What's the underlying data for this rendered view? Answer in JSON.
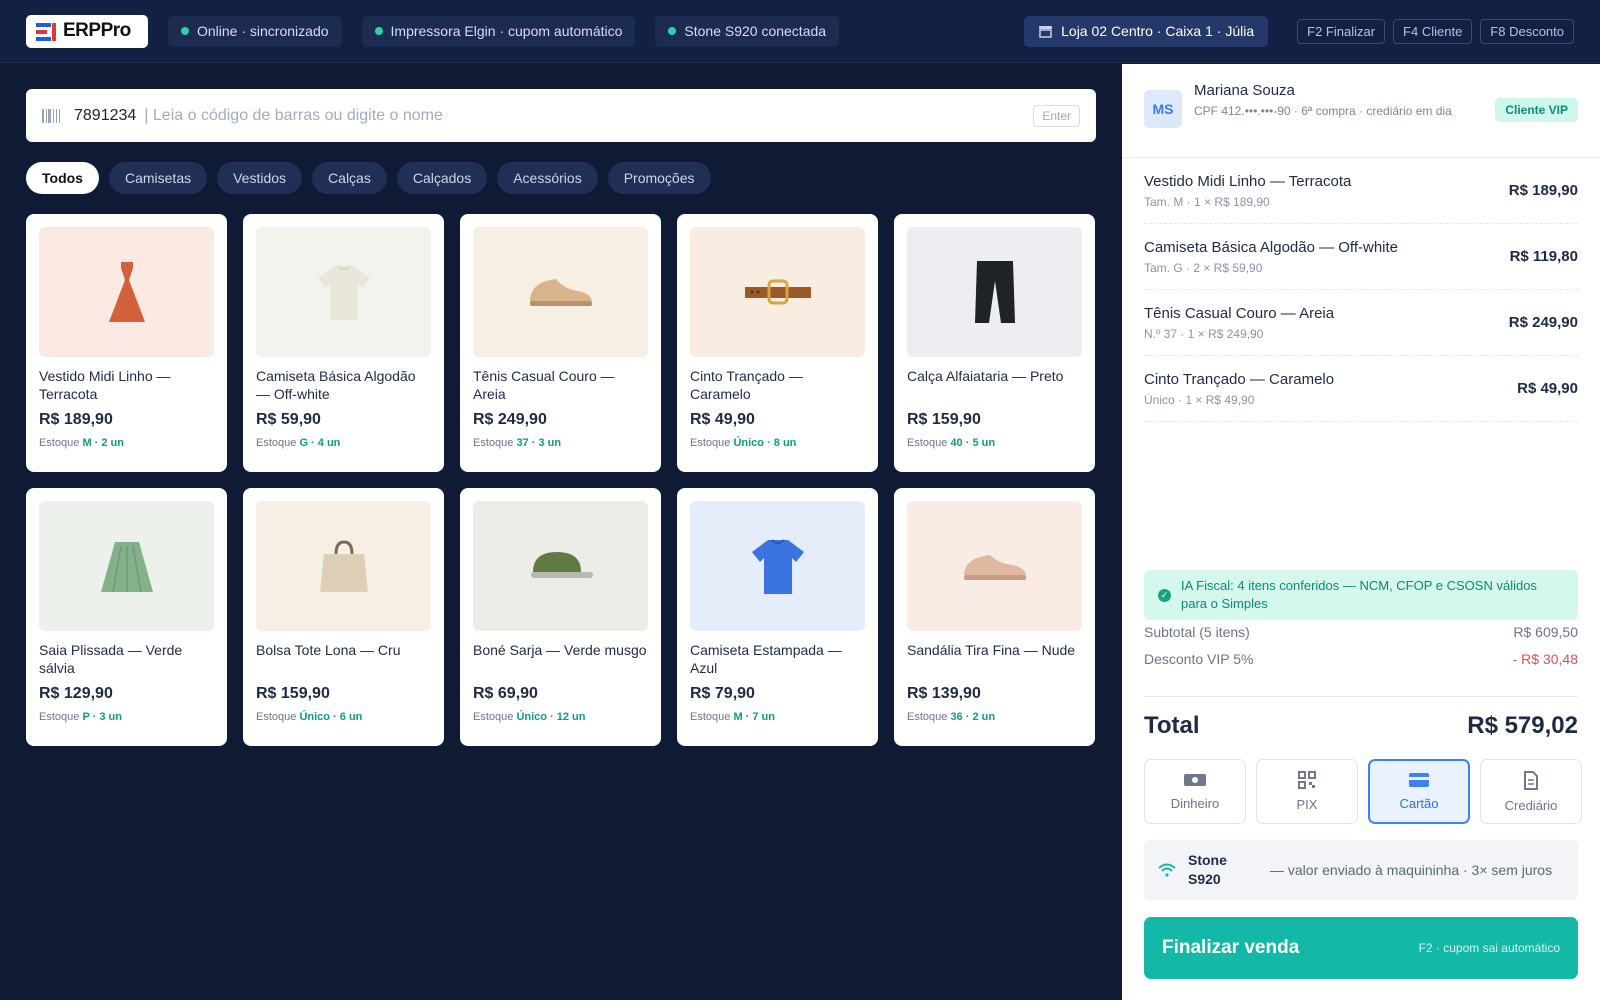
{
  "app": {
    "logo_text": "ERPPro"
  },
  "topbar": {
    "status": [
      {
        "label": "Online · sincronizado"
      },
      {
        "label": "Impressora Elgin · cupom automático"
      },
      {
        "label": "Stone S920 conectada"
      }
    ],
    "store": "Loja 02 Centro · Caixa 1 · Júlia",
    "shortcuts": [
      "F2 Finalizar",
      "F4 Cliente",
      "F8 Desconto"
    ]
  },
  "search": {
    "value": "7891234",
    "placeholder": "| Leia o código de barras ou digite o nome",
    "enter_label": "Enter"
  },
  "categories": [
    "Todos",
    "Camisetas",
    "Vestidos",
    "Calças",
    "Calçados",
    "Acessórios",
    "Promoções"
  ],
  "products": [
    {
      "name": "Vestido Midi Linho — Terracota",
      "price": "R$ 189,90",
      "stock_label": "Estoque",
      "stock": "M · 2 un",
      "icon": "dress-icon",
      "bg": "#fbe9e3"
    },
    {
      "name": "Camiseta Básica Algodão — Off-white",
      "price": "R$ 59,90",
      "stock_label": "Estoque",
      "stock": "G · 4 un",
      "icon": "tshirt-icon",
      "bg": "#f3f2ec"
    },
    {
      "name": "Tênis Casual Couro — Areia",
      "price": "R$ 249,90",
      "stock_label": "Estoque",
      "stock": "37 · 3 un",
      "icon": "sneaker-icon",
      "bg": "#f8efe3"
    },
    {
      "name": "Cinto Trançado — Caramelo",
      "price": "R$ 49,90",
      "stock_label": "Estoque",
      "stock": "Único · 8 un",
      "icon": "belt-icon",
      "bg": "#f8ede0"
    },
    {
      "name": "Calça Alfaiataria — Preto",
      "price": "R$ 159,90",
      "stock_label": "Estoque",
      "stock": "40 · 5 un",
      "icon": "pants-icon",
      "bg": "#eceef2"
    },
    {
      "name": "Saia Plissada — Verde sálvia",
      "price": "R$ 129,90",
      "stock_label": "Estoque",
      "stock": "P · 3 un",
      "icon": "skirt-icon",
      "bg": "#ecf1ec"
    },
    {
      "name": "Bolsa Tote Lona — Cru",
      "price": "R$ 159,90",
      "stock_label": "Estoque",
      "stock": "Único · 6 un",
      "icon": "bag-icon",
      "bg": "#f5efe6"
    },
    {
      "name": "Boné Sarja — Verde musgo",
      "price": "R$ 69,90",
      "stock_label": "Estoque",
      "stock": "Único · 12 un",
      "icon": "cap-icon",
      "bg": "#ecede6"
    },
    {
      "name": "Camiseta Estampada — Azul",
      "price": "R$ 79,90",
      "stock_label": "Estoque",
      "stock": "M · 7 un",
      "icon": "tshirt-icon",
      "bg": "#e5edfb"
    },
    {
      "name": "Sandália Tira Fina — Nude",
      "price": "R$ 139,90",
      "stock_label": "Estoque",
      "stock": "36 · 2 un",
      "icon": "sandal-icon",
      "bg": "#f9ece5"
    }
  ],
  "customer": {
    "initials": "MS",
    "name": "Mariana Souza",
    "sub": "CPF 412.•••.•••-90 · 6ª compra · crediário em dia",
    "badge": "Cliente VIP"
  },
  "cart": [
    {
      "name": "Vestido Midi Linho — Terracota",
      "sub": "Tam. M · 1 × R$ 189,90",
      "total": "R$ 189,90"
    },
    {
      "name": "Camiseta Básica Algodão — Off-white",
      "sub": "Tam. G · 2 × R$ 59,90",
      "total": "R$ 119,80"
    },
    {
      "name": "Tênis Casual Couro — Areia",
      "sub": "N.º 37 · 1 × R$ 249,90",
      "total": "R$ 249,90"
    },
    {
      "name": "Cinto Trançado — Caramelo",
      "sub": "Único · 1 × R$ 49,90",
      "total": "R$ 49,90"
    }
  ],
  "fiscal": {
    "text": "IA Fiscal: 4 itens conferidos — NCM, CFOP e CSOSN válidos para o Simples"
  },
  "summary": {
    "subtotal_label": "Subtotal (5 itens)",
    "subtotal": "R$ 609,50",
    "discount_label": "Desconto VIP 5%",
    "discount": "- R$ 30,48",
    "total_label": "Total",
    "total": "R$ 579,02"
  },
  "payments": [
    {
      "label": "Dinheiro",
      "icon": "cash-icon",
      "active": false
    },
    {
      "label": "PIX",
      "icon": "qr-icon",
      "active": false
    },
    {
      "label": "Cartão",
      "icon": "card-icon",
      "active": true
    },
    {
      "label": "Crediário",
      "icon": "document-icon",
      "active": false
    }
  ],
  "terminal": {
    "name": "Stone S920",
    "desc": "— valor enviado à maquininha · 3× sem juros"
  },
  "finalize": {
    "label": "Finalizar venda",
    "hint": "F2 · cupom sai automático"
  },
  "colors": {
    "bg": "#0f1b35",
    "accent": "#14b8a6",
    "active_blue": "#3b82f6",
    "stock_green": "#0e9c83"
  }
}
